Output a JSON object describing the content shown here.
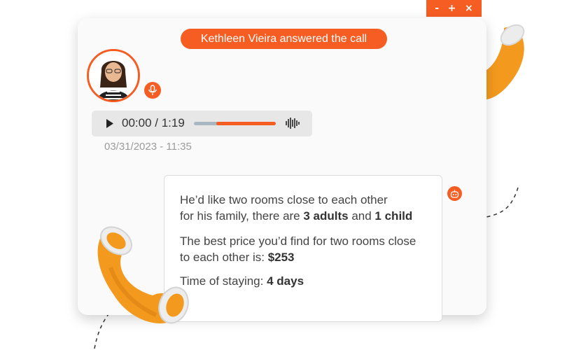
{
  "window_controls": {
    "minimize": "-",
    "maximize": "+",
    "close": "×"
  },
  "banner": {
    "text": "Kethleen Vieira answered the call"
  },
  "caller": {
    "avatar_icon": "person-avatar",
    "mic_icon": "microphone-icon"
  },
  "audio_player": {
    "time": "00:00 / 1:19",
    "progress": 0.27,
    "play_icon": "play-icon",
    "waveform_icon": "waveform-icon"
  },
  "timestamp": "03/31/2023 - 11:35",
  "message": {
    "line1": "He’d like two rooms close to each other",
    "line2_prefix": "for his family, there are ",
    "line2_adults": "3 adults",
    "line2_and": " and ",
    "line2_child": "1 child",
    "line3": "The best price you’d find for two rooms close",
    "line4_prefix": "to each other is: ",
    "line4_price": "$253",
    "line5_prefix": "Time of staying: ",
    "line5_days": "4 days",
    "bot_icon": "robot-icon"
  },
  "colors": {
    "accent": "#f55d23",
    "handset": "#f39a1e"
  }
}
